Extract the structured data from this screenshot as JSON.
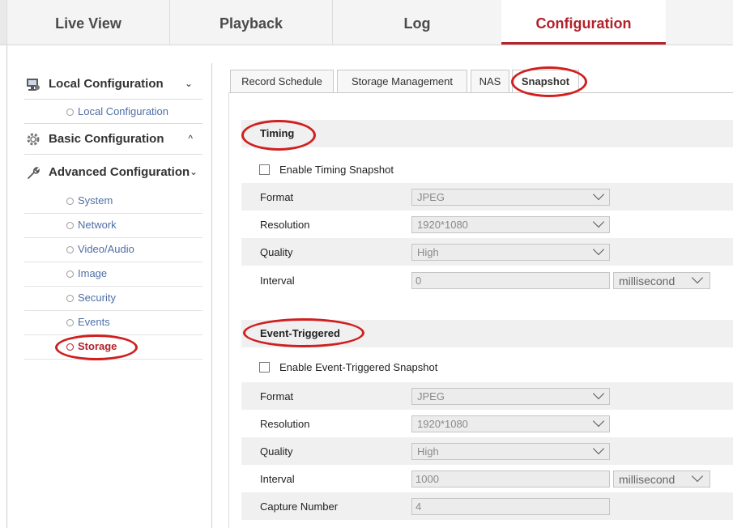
{
  "top_nav": {
    "tabs": [
      {
        "label": "Live View"
      },
      {
        "label": "Playback"
      },
      {
        "label": "Log"
      },
      {
        "label": "Configuration"
      }
    ]
  },
  "sidebar": {
    "local_group": {
      "label": "Local Configuration",
      "chevron": "⌄",
      "icon": "monitor-icon"
    },
    "local_items": [
      {
        "label": "Local Configuration"
      }
    ],
    "basic_group": {
      "label": "Basic Configuration",
      "chevron": "^",
      "icon": "gear-icon"
    },
    "advanced_group": {
      "label": "Advanced Configuration",
      "chevron": "⌄",
      "icon": "wrench-icon"
    },
    "advanced_items": [
      {
        "label": "System"
      },
      {
        "label": "Network"
      },
      {
        "label": "Video/Audio"
      },
      {
        "label": "Image"
      },
      {
        "label": "Security"
      },
      {
        "label": "Events"
      },
      {
        "label": "Storage"
      }
    ]
  },
  "content_tabs": [
    {
      "label": "Record Schedule"
    },
    {
      "label": "Storage Management"
    },
    {
      "label": "NAS"
    },
    {
      "label": "Snapshot"
    }
  ],
  "timing": {
    "title": "Timing",
    "enable_label": "Enable Timing Snapshot",
    "enabled": false,
    "format_label": "Format",
    "format_value": "JPEG",
    "resolution_label": "Resolution",
    "resolution_value": "1920*1080",
    "quality_label": "Quality",
    "quality_value": "High",
    "interval_label": "Interval",
    "interval_value": "0",
    "interval_unit": "millisecond"
  },
  "event": {
    "title": "Event-Triggered",
    "enable_label": "Enable Event-Triggered Snapshot",
    "enabled": false,
    "format_label": "Format",
    "format_value": "JPEG",
    "resolution_label": "Resolution",
    "resolution_value": "1920*1080",
    "quality_label": "Quality",
    "quality_value": "High",
    "interval_label": "Interval",
    "interval_value": "1000",
    "interval_unit": "millisecond",
    "capture_label": "Capture Number",
    "capture_value": "4"
  },
  "colors": {
    "accent": "#b3212b",
    "annotation": "#d01f1f",
    "link": "#4f6fa6"
  }
}
